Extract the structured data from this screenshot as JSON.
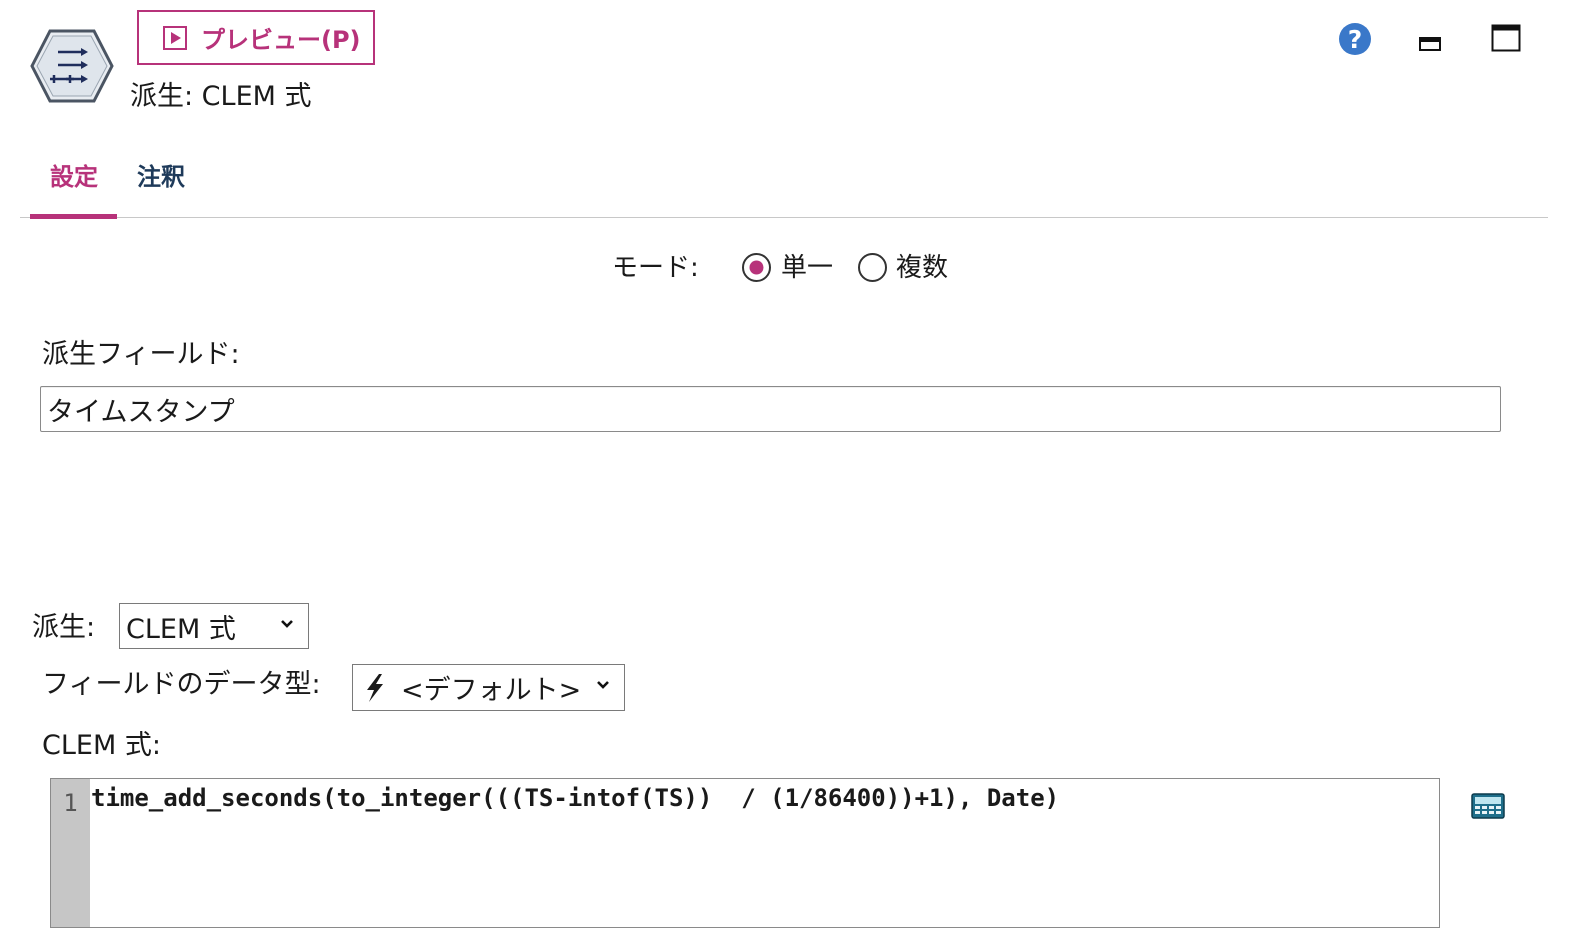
{
  "header": {
    "preview_label": "プレビュー(P)",
    "node_title": "派生: CLEM 式"
  },
  "icons": {
    "node": "derive-node-icon",
    "play": "play-icon",
    "help": "help-icon",
    "minimize": "minimize-icon",
    "maximize": "maximize-icon",
    "dropdown": "chevron-down-icon",
    "type": "lightning-icon",
    "expression_builder": "calculator-icon"
  },
  "tabs": [
    {
      "label": "設定",
      "active": true
    },
    {
      "label": "注釈",
      "active": false
    }
  ],
  "mode": {
    "label": "モード:",
    "options": [
      {
        "label": "単一",
        "selected": true
      },
      {
        "label": "複数",
        "selected": false
      }
    ]
  },
  "derive_field": {
    "label": "派生フィールド:",
    "value": "タイムスタンプ"
  },
  "derive_as": {
    "label": "派生:",
    "selected": "CLEM 式"
  },
  "field_type": {
    "label": "フィールドのデータ型:",
    "selected": "<デフォルト>"
  },
  "expression": {
    "label": "CLEM 式:",
    "line_number": "1",
    "code": "time_add_seconds(to_integer(((TS-intof(TS))  / (1/86400))+1), Date)"
  },
  "colors": {
    "accent": "#b7327a",
    "tab_inactive": "#1e3a5a",
    "help_blue": "#3a78c9",
    "gutter": "#c6c6c6"
  }
}
